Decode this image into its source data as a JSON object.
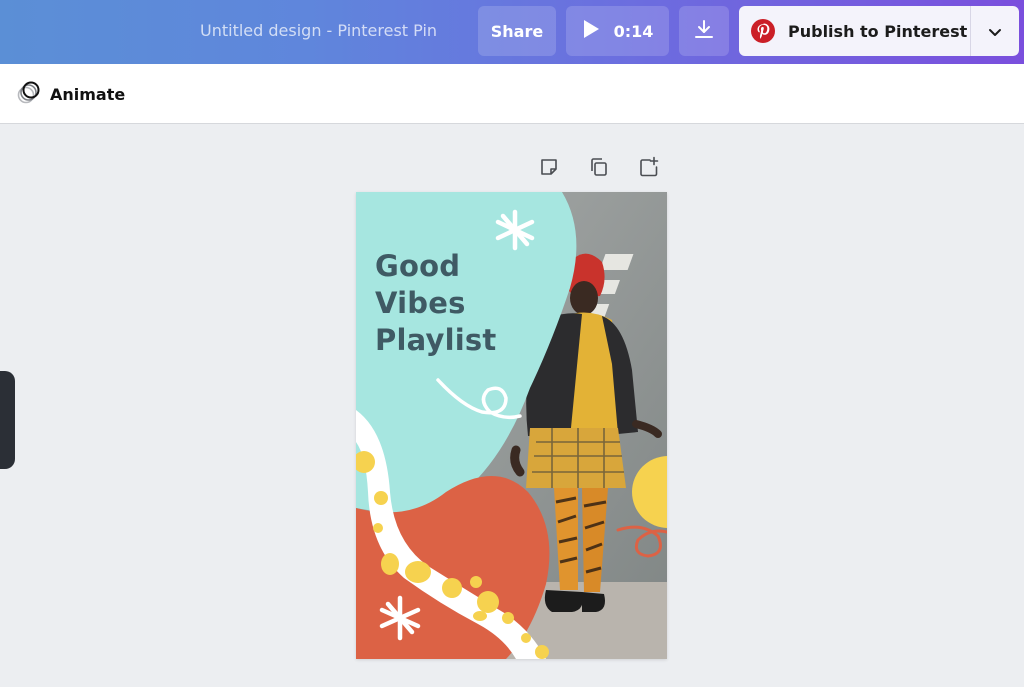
{
  "header": {
    "doc_title": "Untitled design - Pinterest Pin",
    "share_label": "Share",
    "play_duration": "0:14",
    "download_icon": "download-icon",
    "publish_label": "Publish to Pinterest",
    "publish_icon": "pinterest-logo-icon",
    "gradient_start": "#5b8fd6",
    "gradient_end": "#7a4fdd"
  },
  "toolbar": {
    "animate_label": "Animate",
    "animate_icon": "animate-circles-icon"
  },
  "page_tools": [
    {
      "name": "add-note-icon"
    },
    {
      "name": "duplicate-page-icon"
    },
    {
      "name": "add-page-icon"
    }
  ],
  "design": {
    "headline": [
      "Good",
      "Vibes",
      "Playlist"
    ],
    "colors": {
      "mint": "#a6e6e0",
      "coral": "#dc6245",
      "yellow": "#f6d24f",
      "headline": "#3f5a64"
    }
  }
}
